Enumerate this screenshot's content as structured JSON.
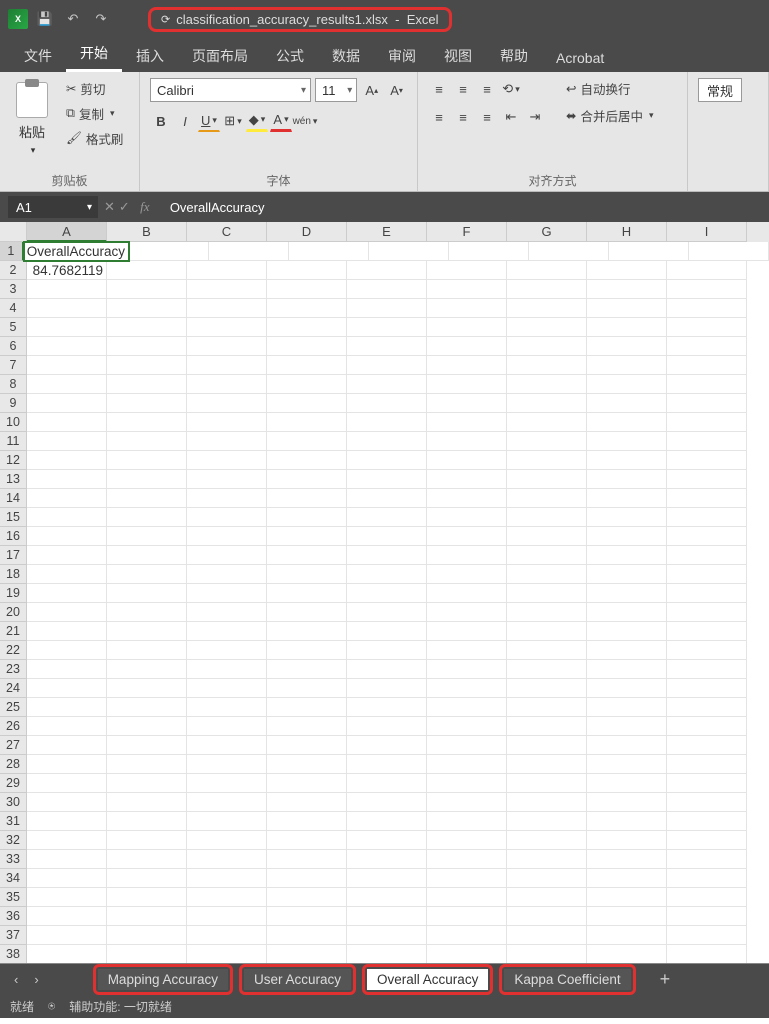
{
  "title": {
    "filename": "classification_accuracy_results1.xlsx",
    "app": "Excel"
  },
  "menu": [
    "文件",
    "开始",
    "插入",
    "页面布局",
    "公式",
    "数据",
    "审阅",
    "视图",
    "帮助",
    "Acrobat"
  ],
  "menu_active_index": 1,
  "ribbon": {
    "clipboard": {
      "paste": "粘贴",
      "cut": "剪切",
      "copy": "复制",
      "formatpainter": "格式刷",
      "group": "剪贴板"
    },
    "font": {
      "name": "Calibri",
      "size": "11",
      "btns": [
        "B",
        "I",
        "U"
      ],
      "wenA": "wén",
      "group": "字体"
    },
    "align": {
      "wrap": "自动换行",
      "merge": "合并后居中",
      "group": "对齐方式"
    },
    "number": {
      "format": "常规"
    }
  },
  "namebox": "A1",
  "formula": "OverallAccuracy",
  "columns": [
    "A",
    "B",
    "C",
    "D",
    "E",
    "F",
    "G",
    "H",
    "I"
  ],
  "rows": 38,
  "cells": {
    "A1": {
      "v": "OverallAccuracy",
      "align": "l"
    },
    "A2": {
      "v": "84.7682119",
      "align": "r"
    }
  },
  "sheets": [
    "Mapping Accuracy",
    "User Accuracy",
    "Overall Accuracy",
    "Kappa Coefficient"
  ],
  "active_sheet_index": 2,
  "status": {
    "ready": "就绪",
    "access": "辅助功能: 一切就绪"
  }
}
